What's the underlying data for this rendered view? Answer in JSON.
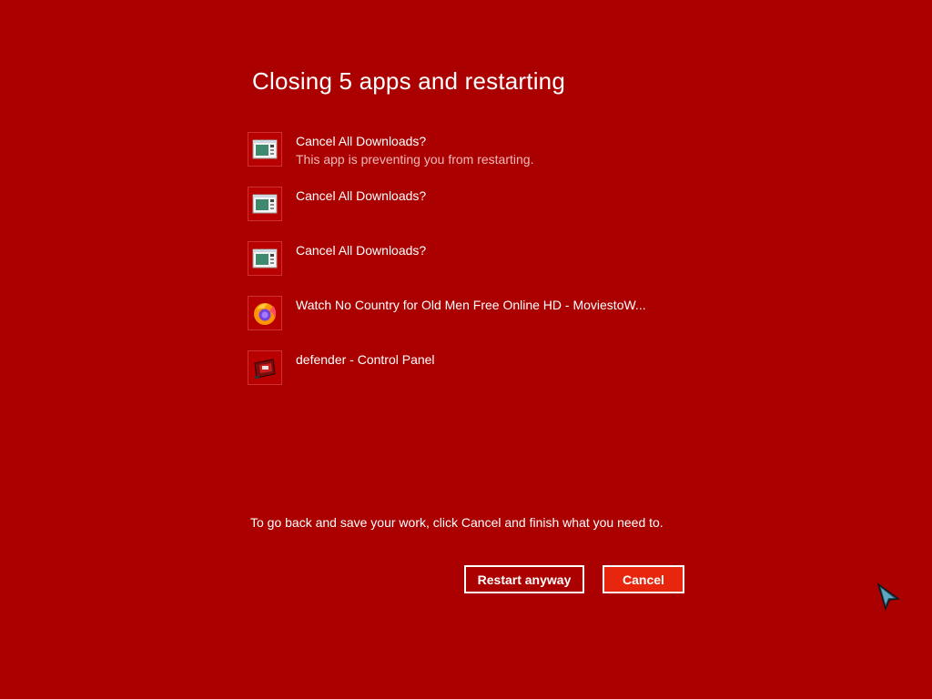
{
  "dialog": {
    "title": "Closing 5 apps and restarting",
    "apps": [
      {
        "name": "Cancel All Downloads?",
        "subtitle": "This app is preventing you from restarting.",
        "icon": "download-dialog-icon"
      },
      {
        "name": "Cancel All Downloads?",
        "subtitle": "",
        "icon": "download-dialog-icon"
      },
      {
        "name": "Cancel All Downloads?",
        "subtitle": "",
        "icon": "download-dialog-icon"
      },
      {
        "name": "Watch No Country for Old Men Free Online HD - MoviestoW...",
        "subtitle": "",
        "icon": "firefox-icon"
      },
      {
        "name": "defender - Control Panel",
        "subtitle": "",
        "icon": "control-panel-icon"
      }
    ],
    "instruction": "To go back and save your work, click Cancel and finish what you need to.",
    "restart_label": "Restart anyway",
    "cancel_label": "Cancel"
  },
  "colors": {
    "background": "#ab0000",
    "accent_button": "#e8260e",
    "text": "#ffffff",
    "subtext": "#f2b8b8"
  }
}
